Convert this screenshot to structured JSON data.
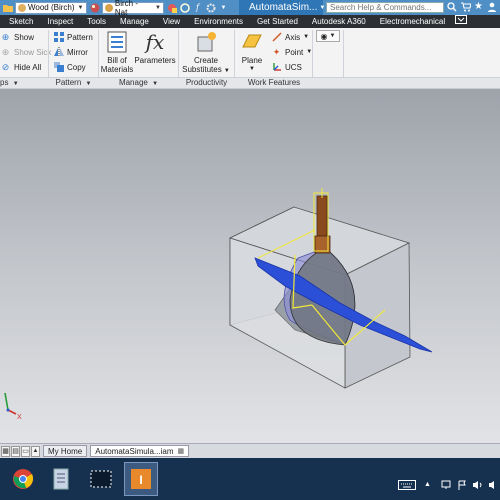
{
  "quick_access": {
    "material_value": "Wood (Birch)",
    "appearance_value": "Birch - Nat",
    "material_swatch_color": "#e0b060",
    "appearance_swatch_color": "#d7a24a"
  },
  "title": {
    "app_tab_label": "AutomataSim...",
    "search_placeholder": "Search Help & Commands..."
  },
  "ribbon_tabs": [
    "Sketch",
    "Inspect",
    "Tools",
    "Manage",
    "View",
    "Environments",
    "Get Started",
    "Autodesk A360",
    "Electromechanical"
  ],
  "ribbon": {
    "show_label": "Show",
    "show_sick_label": "Show Sick",
    "hide_all_label": "Hide All",
    "pattern_label": "Pattern",
    "mirror_label": "Mirror",
    "copy_label": "Copy",
    "bom_label_1": "Bill of",
    "bom_label_2": "Materials",
    "parameters_label": "Parameters",
    "create_label_1": "Create",
    "create_label_2": "Substitutes",
    "plane_label": "Plane",
    "axis_label": "Axis",
    "point_label": "Point",
    "ucs_label": "UCS",
    "panels": {
      "relationships": "ps",
      "pattern": "Pattern",
      "manage": "Manage",
      "productivity": "Productivity",
      "work_features": "Work Features"
    }
  },
  "doc_tabs": {
    "home_label": "My Home",
    "doc_label": "AutomataSimula...iam"
  },
  "axis": {
    "x_label": "X"
  },
  "colors": {
    "title_bar": "#4f8fc6",
    "ribbon_tab_bar": "#2c2f34",
    "taskbar": "#16304f",
    "work_plane": "#2b4fd6",
    "rod": "#8b4a1e"
  }
}
